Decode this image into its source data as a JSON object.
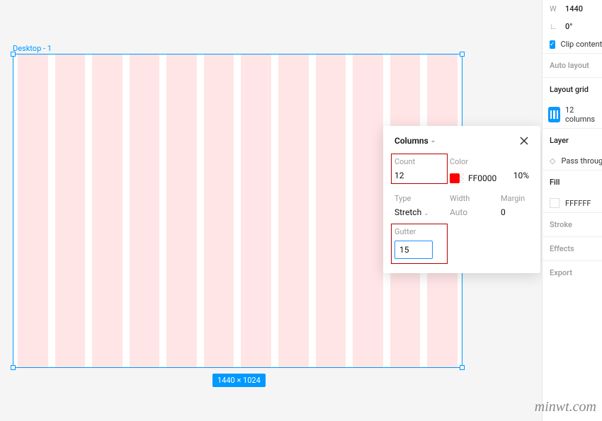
{
  "frame": {
    "label": "Desktop - 1",
    "dim_badge": "1440 × 1024"
  },
  "popup": {
    "title": "Columns",
    "count_label": "Count",
    "count_value": "12",
    "color_label": "Color",
    "color_hex": "FF0000",
    "color_opacity": "10%",
    "type_label": "Type",
    "type_value": "Stretch",
    "width_label": "Width",
    "width_value": "Auto",
    "margin_label": "Margin",
    "margin_value": "0",
    "gutter_label": "Gutter",
    "gutter_value": "15"
  },
  "panel": {
    "w_label": "W",
    "w_value": "1440",
    "angle_label": "∟",
    "angle_value": "0°",
    "clip_label": "Clip content",
    "autolayout": "Auto layout",
    "layoutgrid_title": "Layout grid",
    "layoutgrid_item": "12 columns",
    "layer_title": "Layer",
    "layer_mode": "Pass through",
    "fill_title": "Fill",
    "fill_hex": "FFFFFF",
    "stroke_title": "Stroke",
    "effects_title": "Effects",
    "export_title": "Export"
  },
  "watermark": "minwt.com"
}
